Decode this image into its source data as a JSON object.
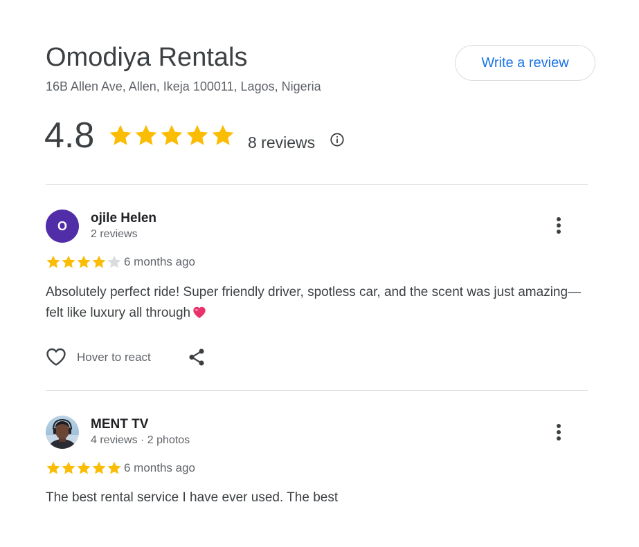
{
  "business": {
    "name": "Omodiya Rentals",
    "address": "16B Allen Ave, Allen, Ikeja 100011, Lagos, Nigeria",
    "rating": "4.8",
    "rating_value": 4.8,
    "review_count_label": "8 reviews"
  },
  "actions": {
    "write_review_label": "Write a review"
  },
  "colors": {
    "star_filled": "#fbbc04",
    "star_empty": "#dadce0",
    "link_blue": "#1a73e8",
    "avatar_purple": "#512da8",
    "heart_emoji": "#e8336d"
  },
  "reviews": [
    {
      "avatar_letter": "O",
      "name": "ojile Helen",
      "meta": "2 reviews",
      "stars": 4,
      "time": "6 months ago",
      "text": "Absolutely perfect ride! Super friendly driver, spotless car, and the scent was just amazing—felt like luxury all through",
      "react_label": "Hover to react",
      "icons": [
        "heart-outline-icon",
        "share-icon",
        "more-vert-icon"
      ]
    },
    {
      "name": "MENT TV",
      "meta": "4 reviews · 2 photos",
      "stars": 5,
      "time": "6 months ago",
      "text": "The best rental service I have ever used. The best",
      "icons": [
        "more-vert-icon"
      ]
    }
  ]
}
